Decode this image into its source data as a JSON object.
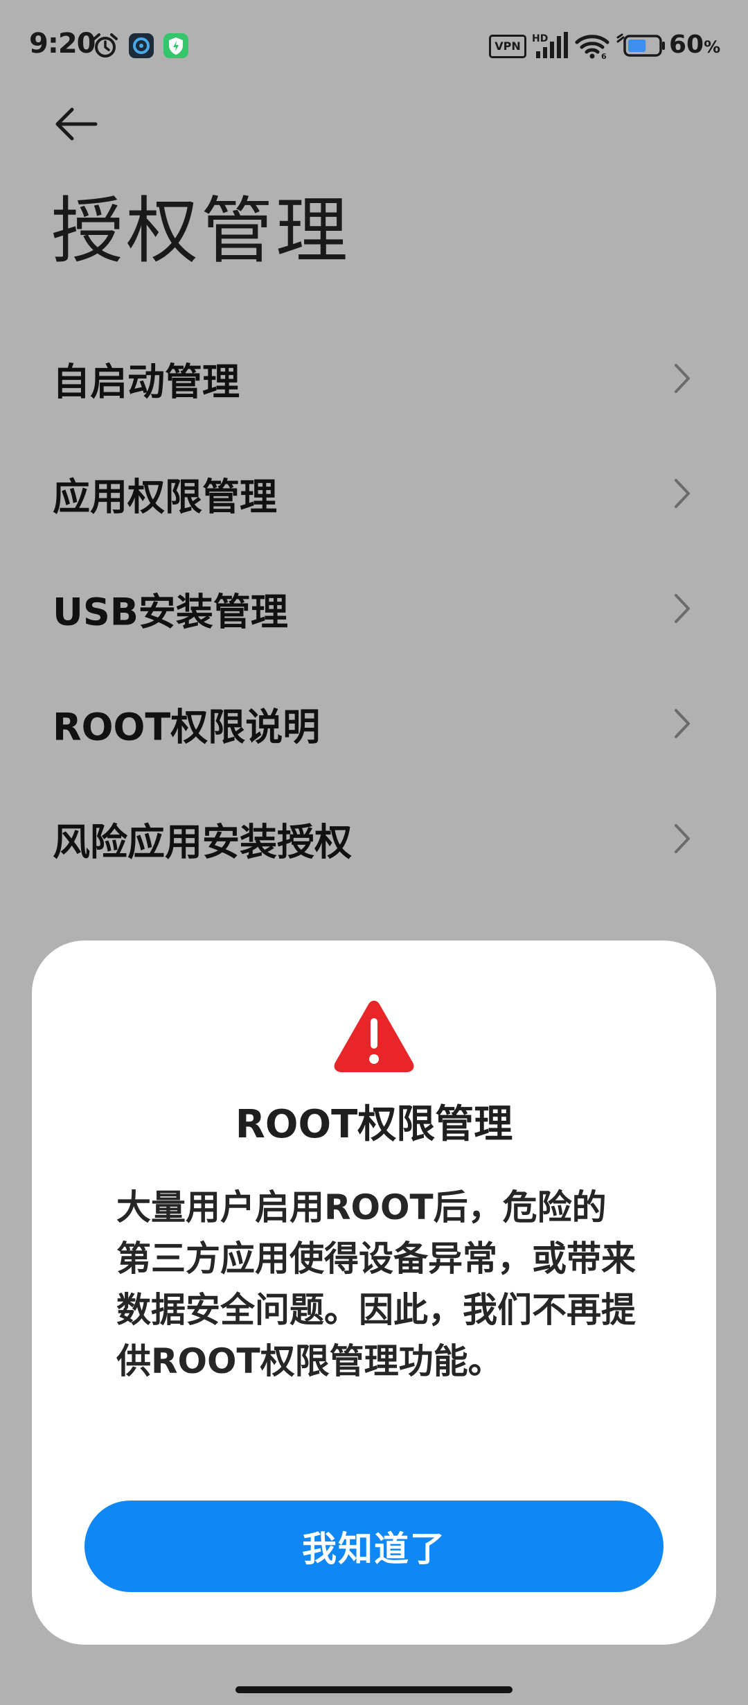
{
  "status_bar": {
    "time": "9:20",
    "vpn_label": "VPN",
    "network_label": "HD",
    "battery_value": "60",
    "battery_unit": "%",
    "battery_level": 0.6,
    "icons": [
      "alarm-icon",
      "app-notification-icon",
      "security-app-icon",
      "signal-icon",
      "wifi-icon",
      "battery-icon"
    ]
  },
  "header": {
    "back_icon": "back-arrow-icon",
    "title": "授权管理"
  },
  "menu": {
    "items": [
      {
        "label": "自启动管理"
      },
      {
        "label": "应用权限管理"
      },
      {
        "label": "USB安装管理"
      },
      {
        "label": "ROOT权限说明"
      },
      {
        "label": "风险应用安装授权"
      }
    ],
    "chevron_icon": "chevron-right-icon"
  },
  "dialog": {
    "icon": "warning-icon",
    "title": "ROOT权限管理",
    "message": "大量用户启用ROOT后，危险的第三方应用使得设备异常，或带来数据安全问题。因此，我们不再提供ROOT权限管理功能。",
    "button_label": "我知道了"
  },
  "colors": {
    "overlay_background": "#b1b1b1",
    "dialog_background": "#ffffff",
    "primary_button": "#0f87f5",
    "warning_red": "#e8262a"
  }
}
